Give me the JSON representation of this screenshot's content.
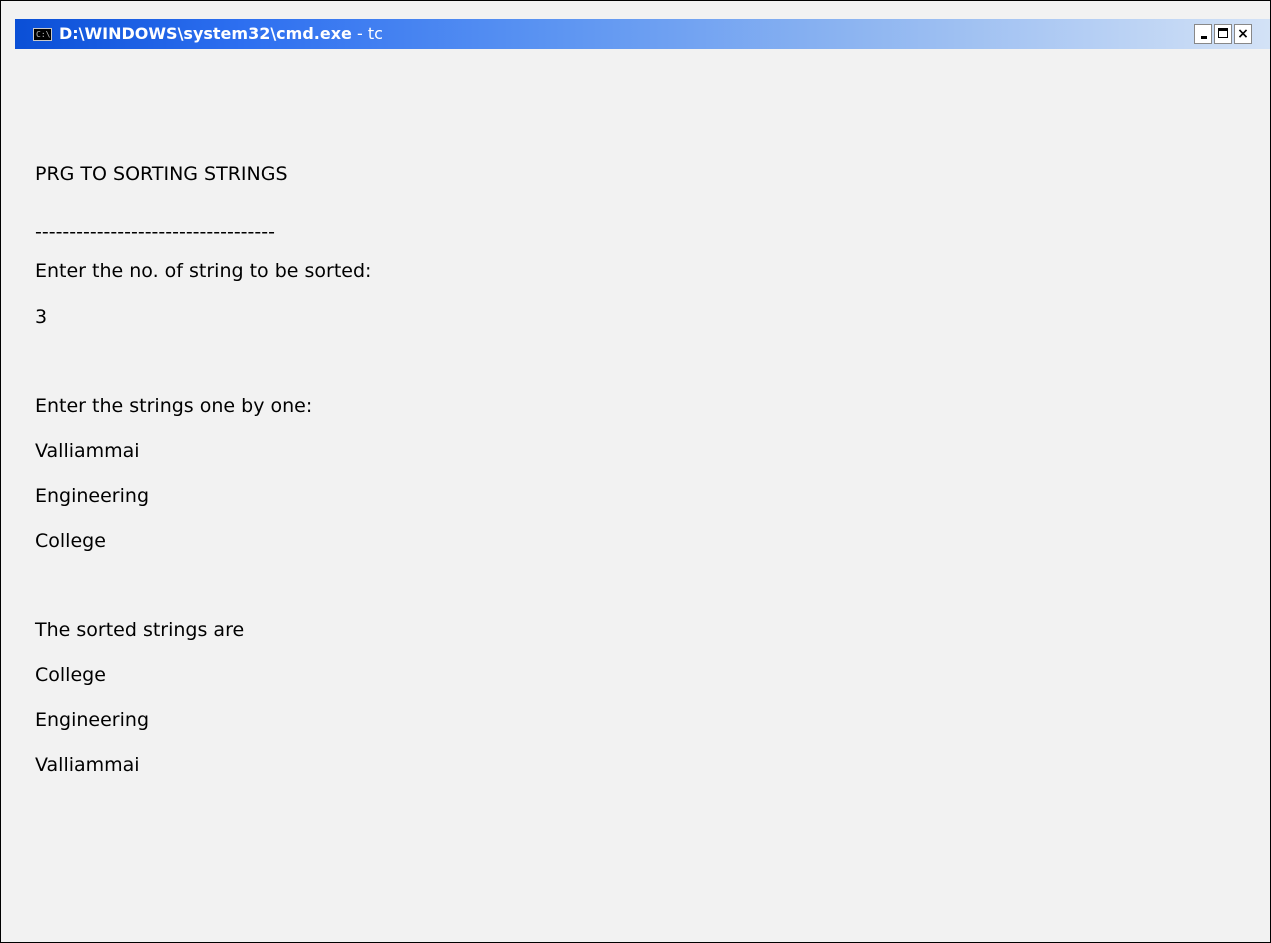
{
  "window": {
    "title": "D:\\WINDOWS\\system32\\cmd.exe",
    "title_suffix": " - tc",
    "icon_text": "C:\\",
    "close_glyph": "×"
  },
  "console": {
    "lines": [
      "PRG TO SORTING STRINGS",
      "-----------------------------------",
      "Enter the no. of string to be sorted:",
      "3",
      "Enter the strings one by one:",
      "Valliammai",
      "Engineering",
      "College",
      "The sorted strings are",
      "College",
      "Engineering",
      "Valliammai"
    ]
  }
}
